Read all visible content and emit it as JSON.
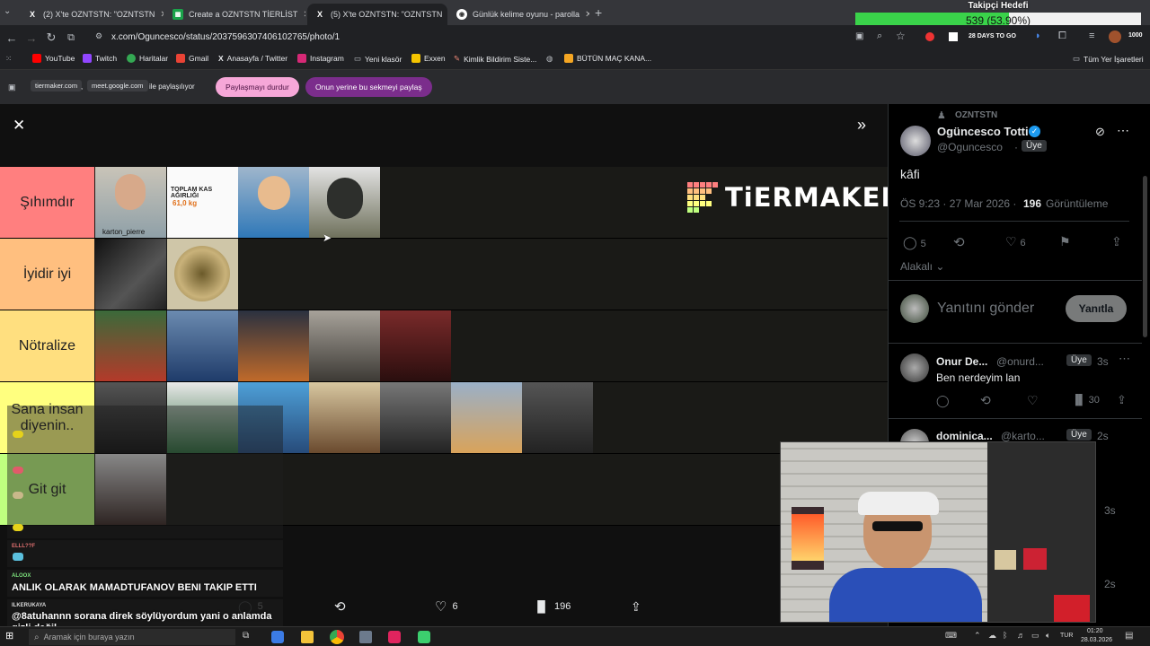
{
  "browser": {
    "tabs": [
      {
        "label": "(2) X'te OZNTSTN: \"OZNTSTN",
        "icon": "x-icon"
      },
      {
        "label": "Create a OZNTSTN TİERLİST",
        "icon": "tiermaker-icon"
      },
      {
        "label": "(5) X'te OZNTSTN: \"OZNTSTN",
        "icon": "x-icon"
      },
      {
        "label": "Günlük kelime oyunu - parolla",
        "icon": "globe-icon"
      }
    ],
    "url": "x.com/Oguncesco/status/2037596307406102765/photo/1",
    "bookmarks": [
      "YouTube",
      "Twitch",
      "Haritalar",
      "Gmail",
      "Anasayfa / Twitter",
      "Instagram",
      "Yeni klasör",
      "Exxen",
      "Kimlik Bildirim Siste...",
      "BÜTÜN MAÇ KANA..."
    ],
    "all_bookmarks": "Tüm Yer İşaretleri",
    "share": {
      "domains": [
        "tiermaker.com",
        "meet.google.com"
      ],
      "sharing_text": "ile paylaşılıyor",
      "stop_label": "Paylaşmayı durdur",
      "share_tab_label": "Onun yerine bu sekmeyi paylaş"
    },
    "ext_text": "28 DAYS TO GO"
  },
  "follower_goal": {
    "title": "Takipçi Hedefi",
    "text": "539 (53.90%)",
    "progress": 0.539,
    "count_right": "1000"
  },
  "tierlist": {
    "tiers": [
      {
        "label": "Şıhımdır",
        "color": "#ff7f7f",
        "count": 4
      },
      {
        "label": "İyidir iyi",
        "color": "#ffbf7f",
        "count": 2
      },
      {
        "label": "Nötralize",
        "color": "#ffdf7f",
        "count": 5
      },
      {
        "label": "Sana insan diyenin..",
        "color": "#ffff7f",
        "count": 7
      },
      {
        "label": "Git git",
        "color": "#bfff7f",
        "count": 1
      }
    ],
    "logo_text": "TiERMAKER",
    "thumb_captions": [
      "karton_pierre",
      "TOPLAM KAS AĞIRLIĞI",
      "61,0 kg"
    ]
  },
  "photo_actions": {
    "replies": "5",
    "likes": "6",
    "views": "196"
  },
  "tweet": {
    "community": "OZNTSTN",
    "display_name": "Ogüncesco Totti",
    "handle": "@Oguncesco",
    "badge": "Üye",
    "text": "kâfi",
    "time": "ÖS 9:23 · 27 Mar 2026 ·",
    "views": "196",
    "views_label": "Görüntüleme",
    "replies": "5",
    "likes": "6",
    "relevance": "Alakalı",
    "reply_placeholder": "Yanıtını gönder",
    "reply_button": "Yanıtla"
  },
  "replies": [
    {
      "name": "Onur De...",
      "handle": "@onurd...",
      "badge": "Üye",
      "time": "3s",
      "text": "Ben nerdeyim lan",
      "views": "30"
    },
    {
      "name": "dominica...",
      "handle": "@karto...",
      "badge": "Üye",
      "time": "2s"
    }
  ],
  "extra_times": [
    "3s",
    "2s"
  ],
  "chat": [
    {
      "name": "ELLL??F",
      "text": ""
    },
    {
      "name": "ALOOX",
      "text": "ANLIK OLARAK MAMADTUFANOV BENI TAKIP ETTI"
    },
    {
      "name": "ILKERUKAYA",
      "text": "@8atuhannn sorana direk söylüyordum yani o anlamda gizli değil"
    }
  ],
  "taskbar": {
    "search": "Aramak için buraya yazın",
    "lang": "TUR",
    "time": "01:20",
    "date": "28.03.2026"
  },
  "colors": {
    "accent": "#1d9bf0",
    "pink": "#f6a7d8",
    "purple": "#7b2d8c"
  }
}
